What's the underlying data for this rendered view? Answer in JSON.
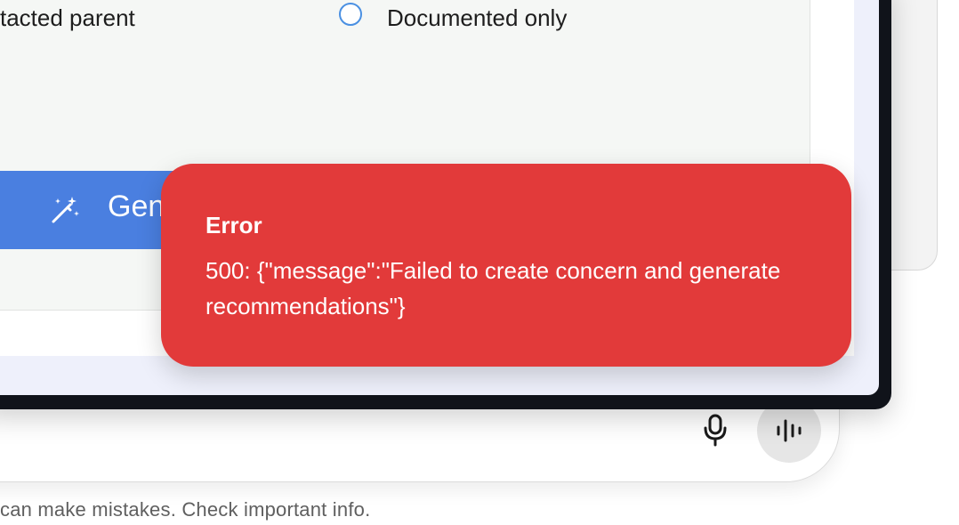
{
  "form": {
    "radio_options": [
      {
        "label": "tacted parent",
        "selected": false
      },
      {
        "label": "Documented only",
        "selected": false
      }
    ],
    "generate_button_label": "Gen"
  },
  "toast": {
    "title": "Error",
    "message": "500: {\"message\":\"Failed to create concern and generate recommendations\"}",
    "background_color": "#e23a3a"
  },
  "composer": {
    "mic_icon": "microphone-icon",
    "voice_icon": "voice-waveform-icon"
  },
  "footer": {
    "disclaimer": "can make mistakes. Check important info."
  },
  "colors": {
    "accent": "#4a7fe0",
    "error": "#e23a3a"
  }
}
